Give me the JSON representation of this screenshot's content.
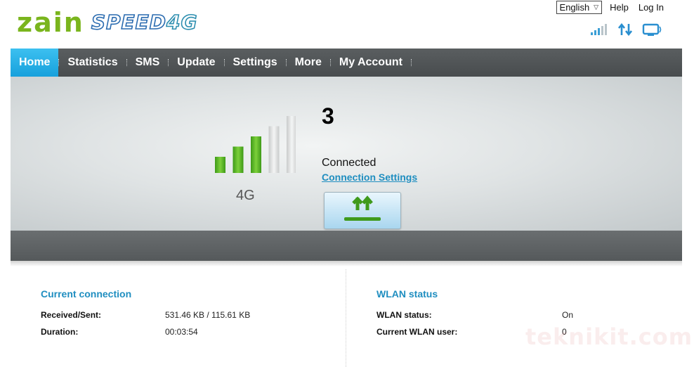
{
  "brand": {
    "name": "zain",
    "product": "SPEED",
    "product_suffix": "4G"
  },
  "top_links": {
    "language": "English",
    "help": "Help",
    "login": "Log In"
  },
  "nav": {
    "items": [
      {
        "label": "Home",
        "active": true
      },
      {
        "label": "Statistics"
      },
      {
        "label": "SMS"
      },
      {
        "label": "Update"
      },
      {
        "label": "Settings"
      },
      {
        "label": "More"
      },
      {
        "label": "My Account"
      }
    ]
  },
  "status": {
    "signal_bars": 3,
    "signal_max": 5,
    "network_type": "4G",
    "isp": "3",
    "connection": "Connected",
    "settings_link": "Connection Settings"
  },
  "current_connection": {
    "title": "Current connection",
    "rows": [
      {
        "label": "Received/Sent:",
        "value": "531.46 KB /  115.61 KB"
      },
      {
        "label": "Duration:",
        "value": "00:03:54"
      }
    ]
  },
  "wlan": {
    "title": "WLAN status",
    "rows": [
      {
        "label": "WLAN status:",
        "value": "On"
      },
      {
        "label": "Current WLAN user:",
        "value": "0"
      }
    ]
  },
  "watermark": "teknikit.com",
  "colors": {
    "accent": "#1f8ec0",
    "nav_active": "#1ea8e2",
    "signal_on": "#5fb323",
    "signal_off": "#d4d6d6"
  }
}
